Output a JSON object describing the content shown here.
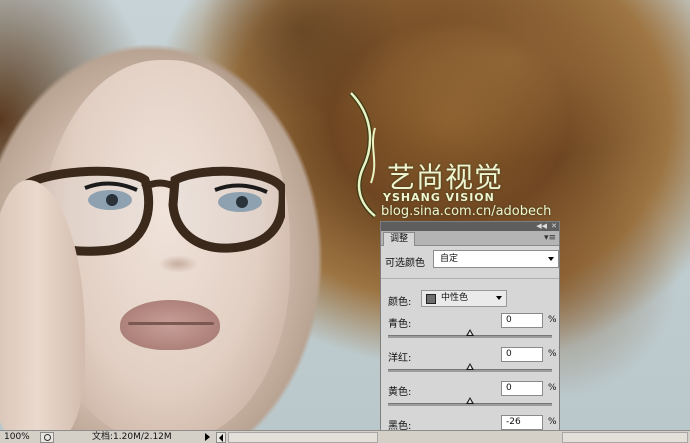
{
  "watermark": {
    "title": "艺尚视觉",
    "subtitle": "YSHANG VISION",
    "url": "blog.sina.com.cn/adobech"
  },
  "panel": {
    "tab_label": "调整",
    "preset_label": "可选颜色",
    "preset_value": "自定",
    "color_label": "颜色:",
    "color_value": "中性色",
    "color_swatch": "#6e6e6e",
    "sliders": [
      {
        "label": "青色:",
        "value": "0",
        "unit": "%",
        "level": 0
      },
      {
        "label": "洋红:",
        "value": "0",
        "unit": "%",
        "level": 0
      },
      {
        "label": "黄色:",
        "value": "0",
        "unit": "%",
        "level": 0
      },
      {
        "label": "黑色:",
        "value": "-26",
        "unit": "%",
        "level": -26
      }
    ]
  },
  "statusbar": {
    "zoom": "100%",
    "doc_info": "文档:1.20M/2.12M"
  }
}
